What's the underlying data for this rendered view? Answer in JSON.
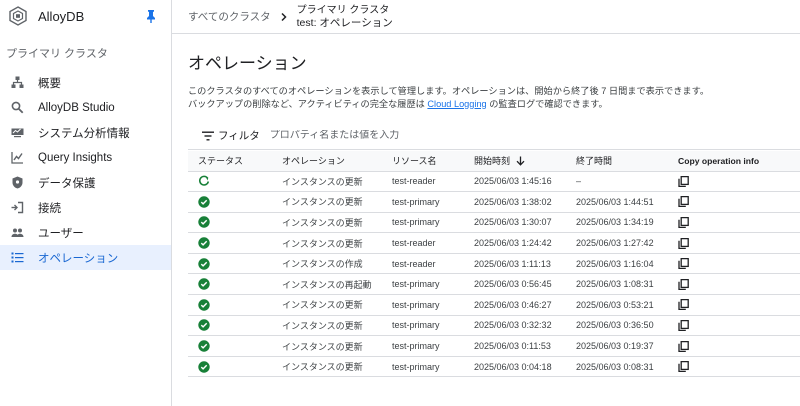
{
  "app": {
    "title": "AlloyDB"
  },
  "sidebar": {
    "section_label": "プライマリ クラスタ",
    "items": [
      {
        "label": "概要",
        "icon": "overview-icon"
      },
      {
        "label": "AlloyDB Studio",
        "icon": "search-icon"
      },
      {
        "label": "システム分析情報",
        "icon": "monitor-icon"
      },
      {
        "label": "Query Insights",
        "icon": "chart-icon"
      },
      {
        "label": "データ保護",
        "icon": "shield-icon"
      },
      {
        "label": "接続",
        "icon": "connection-icon"
      },
      {
        "label": "ユーザー",
        "icon": "users-icon"
      },
      {
        "label": "オペレーション",
        "icon": "list-icon",
        "active": true
      }
    ]
  },
  "breadcrumb": {
    "root": "すべてのクラスタ",
    "cluster_type": "プライマリ クラスタ",
    "current": "test: オペレーション"
  },
  "page": {
    "title": "オペレーション",
    "desc_line1": "このクラスタのすべてのオペレーションを表示して管理します。オペレーションは、開始から終了後 7 日間まで表示できます。",
    "desc_line2_pre": "バックアップの削除など、アクティビティの完全な履歴は ",
    "desc_link": "Cloud Logging",
    "desc_line2_post": " の監査ログで確認できます。"
  },
  "filter": {
    "label": "フィルタ",
    "placeholder": "プロパティ名または値を入力"
  },
  "table": {
    "headers": {
      "status": "ステータス",
      "operation": "オペレーション",
      "resource": "リソース名",
      "start": "開始時刻",
      "end": "終了時間",
      "copy": "Copy operation info"
    },
    "rows": [
      {
        "status": "running",
        "operation": "インスタンスの更新",
        "resource": "test-reader",
        "start": "2025/06/03 1:45:16",
        "end": "–"
      },
      {
        "status": "success",
        "operation": "インスタンスの更新",
        "resource": "test-primary",
        "start": "2025/06/03 1:38:02",
        "end": "2025/06/03 1:44:51"
      },
      {
        "status": "success",
        "operation": "インスタンスの更新",
        "resource": "test-primary",
        "start": "2025/06/03 1:30:07",
        "end": "2025/06/03 1:34:19"
      },
      {
        "status": "success",
        "operation": "インスタンスの更新",
        "resource": "test-reader",
        "start": "2025/06/03 1:24:42",
        "end": "2025/06/03 1:27:42"
      },
      {
        "status": "success",
        "operation": "インスタンスの作成",
        "resource": "test-reader",
        "start": "2025/06/03 1:11:13",
        "end": "2025/06/03 1:16:04"
      },
      {
        "status": "success",
        "operation": "インスタンスの再起動",
        "resource": "test-primary",
        "start": "2025/06/03 0:56:45",
        "end": "2025/06/03 1:08:31"
      },
      {
        "status": "success",
        "operation": "インスタンスの更新",
        "resource": "test-primary",
        "start": "2025/06/03 0:46:27",
        "end": "2025/06/03 0:53:21"
      },
      {
        "status": "success",
        "operation": "インスタンスの更新",
        "resource": "test-primary",
        "start": "2025/06/03 0:32:32",
        "end": "2025/06/03 0:36:50"
      },
      {
        "status": "success",
        "operation": "インスタンスの更新",
        "resource": "test-primary",
        "start": "2025/06/03 0:11:53",
        "end": "2025/06/03 0:19:37"
      },
      {
        "status": "success",
        "operation": "インスタンスの更新",
        "resource": "test-primary",
        "start": "2025/06/03 0:04:18",
        "end": "2025/06/03 0:08:31"
      }
    ]
  },
  "colors": {
    "accent": "#1a73e8",
    "active_bg": "#e8f0fe",
    "success": "#188038",
    "border": "#dadce0"
  }
}
